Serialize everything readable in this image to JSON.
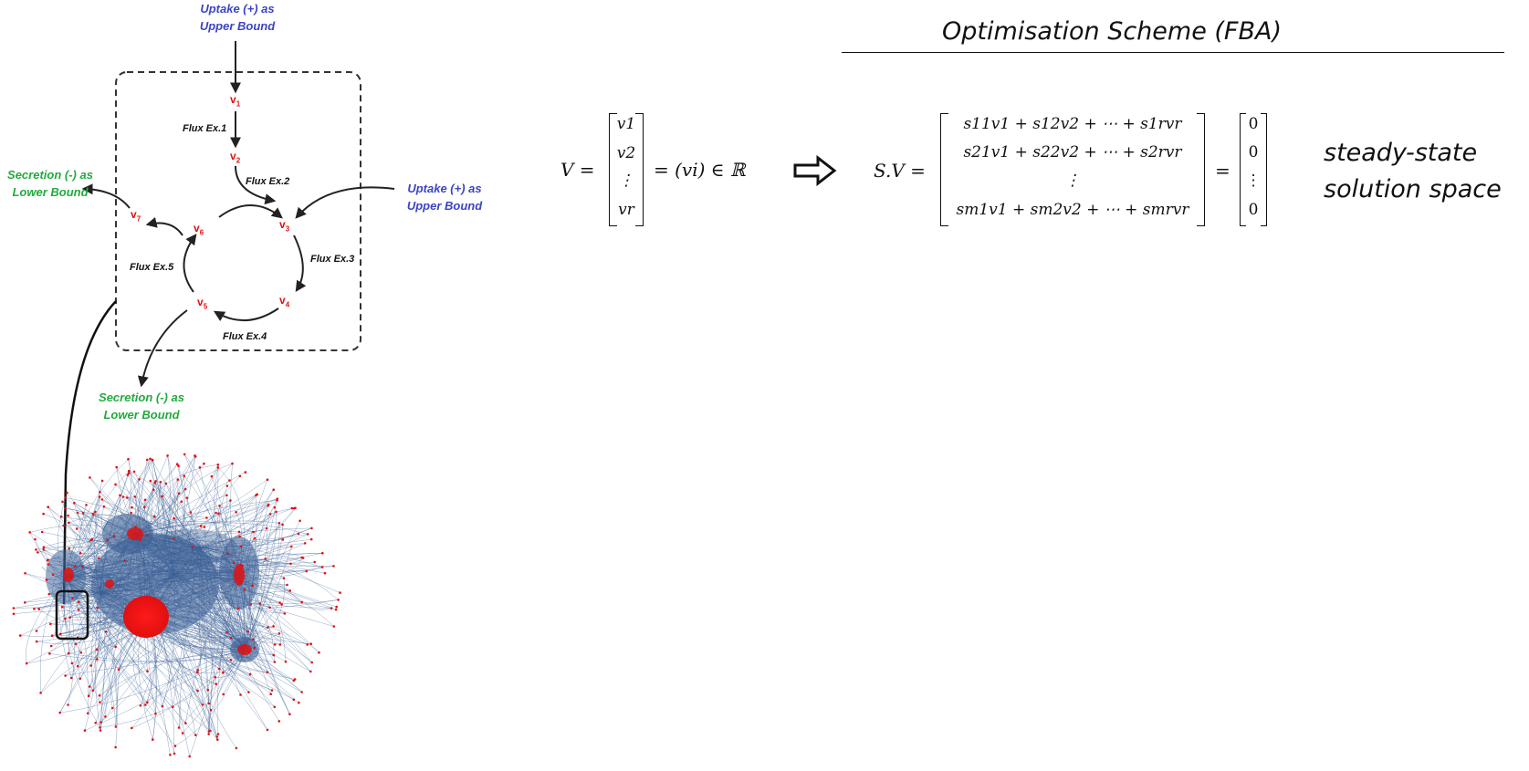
{
  "title": "Optimisation Scheme (FBA)",
  "network": {
    "uptake_top": "Uptake (+) as\nUpper Bound",
    "uptake_right": "Uptake (+) as\nUpper Bound",
    "secretion_left": "Secretion (-) as\nLower Bound",
    "secretion_bottom": "Secretion (-) as\nLower Bound",
    "nodes": [
      {
        "label": "v",
        "sub": "1"
      },
      {
        "label": "v",
        "sub": "2"
      },
      {
        "label": "v",
        "sub": "3"
      },
      {
        "label": "v",
        "sub": "4"
      },
      {
        "label": "v",
        "sub": "5"
      },
      {
        "label": "v",
        "sub": "6"
      },
      {
        "label": "v",
        "sub": "7"
      }
    ],
    "fluxes": [
      "Flux Ex.1",
      "Flux Ex.2",
      "Flux Ex.3",
      "Flux Ex.4",
      "Flux Ex.5"
    ]
  },
  "equation_v": {
    "lhs": "V =",
    "vector": [
      "v1",
      "v2",
      "⋮",
      "vr"
    ],
    "rhs": "= (vi) ∈ ℝ"
  },
  "equation_sv": {
    "lhs": "S.V =",
    "rows": [
      "s11v1 + s12v2 + ⋯ + s1rvr",
      "s21v1 + s22v2 + ⋯ + s2rvr",
      "⋮",
      "sm1v1 + sm2v2 + ⋯ + smrvr"
    ],
    "equals": "=",
    "zeros": [
      "0",
      "0",
      "⋮",
      "0"
    ]
  },
  "note": {
    "line1": "steady-state",
    "line2": "solution space"
  },
  "colors": {
    "uptake": "#3b44c4",
    "secretion": "#22ab3e",
    "node": "#e01010",
    "network_edge": "#3a5f95",
    "network_node": "#e01010"
  }
}
